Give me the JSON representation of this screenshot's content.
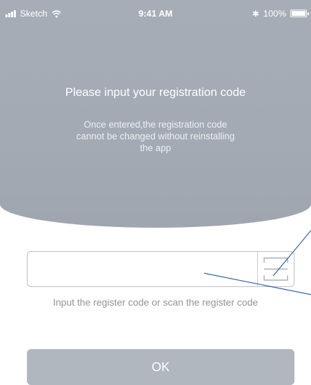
{
  "status_bar": {
    "carrier": "Sketch",
    "time": "9:41 AM",
    "battery": "100%",
    "battery_level": 1.0,
    "icons": [
      "signal-icon",
      "wifi-icon",
      "bluetooth-icon",
      "battery-icon"
    ]
  },
  "header": {
    "title": "Please input your registration code",
    "subtitle": "Once entered,the registration code\ncannot be changed without reinstalling\nthe app"
  },
  "form": {
    "code_value": "",
    "placeholder": "",
    "scan_icon": "scan-code-icon",
    "hint": "Input the register code or scan the register code",
    "ok_label": "OK"
  },
  "colors": {
    "header_bg": "#a3aab4",
    "button_bg": "#b1b7bf",
    "annotation_line": "#2f5fa8"
  }
}
